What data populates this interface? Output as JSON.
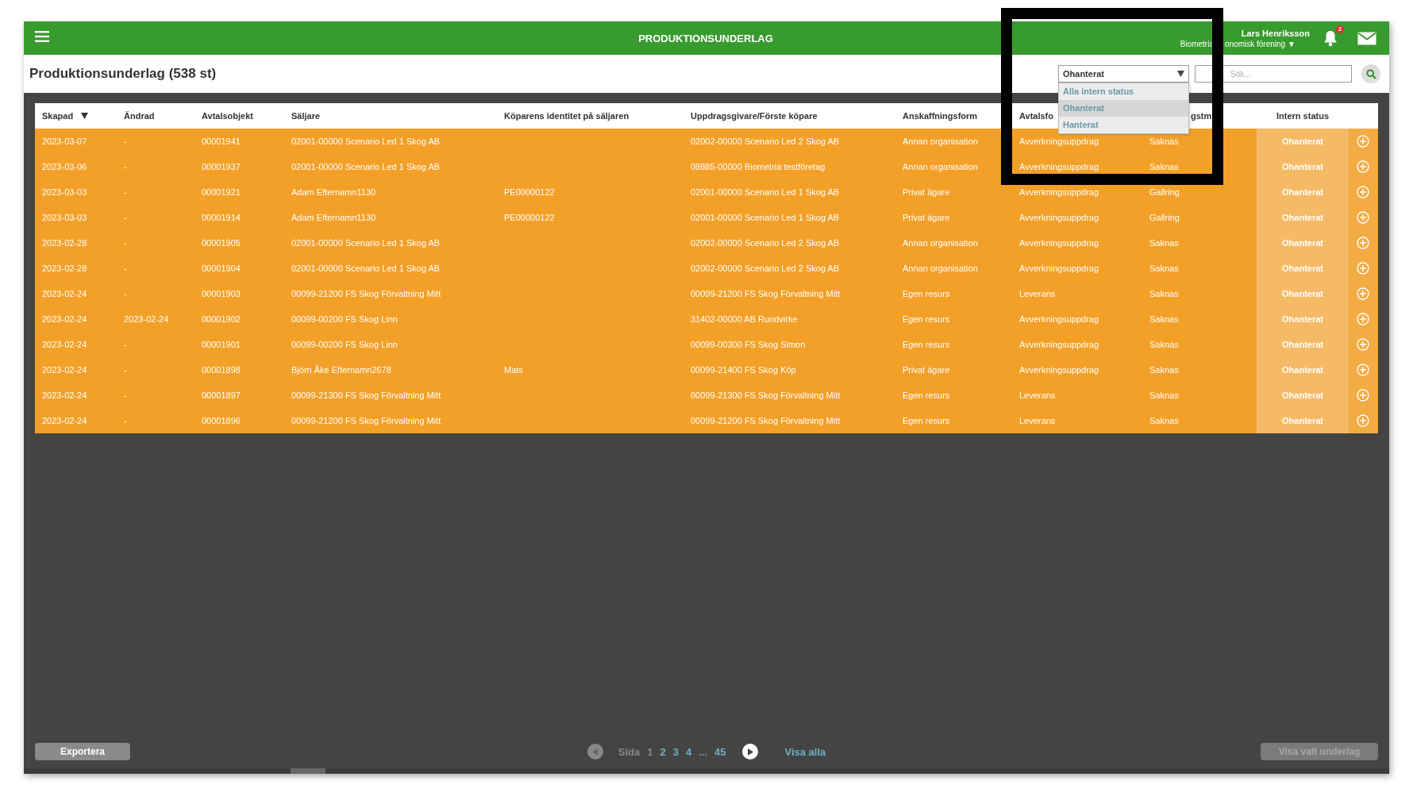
{
  "header": {
    "title": "PRODUKTIONSUNDERLAG",
    "user_name": "Lars Henriksson",
    "organization_visible_parts": [
      "Biometria",
      "onomisk förening ▼"
    ],
    "notification_count": "2"
  },
  "page_title": "Produktionsunderlag (538 st)",
  "status_filter": {
    "value": "Ohanterat",
    "expanded": true,
    "options": [
      {
        "label": "Alla intern status",
        "selected": false
      },
      {
        "label": "Ohanterat",
        "selected": true
      },
      {
        "label": "Hanterat",
        "selected": false
      }
    ]
  },
  "search": {
    "placeholder": "Sök..."
  },
  "table": {
    "columns": [
      {
        "label": "Skapad",
        "sorted": true
      },
      {
        "label": "Ändrad",
        "sorted": false
      },
      {
        "label": "Avtalsobjekt",
        "sorted": false
      },
      {
        "label": "Säljare",
        "sorted": false
      },
      {
        "label": "Köparens identitet på säljaren",
        "sorted": false
      },
      {
        "label": "Uppdragsgivare/Förste köpare",
        "sorted": false
      },
      {
        "label": "Anskaffningsform",
        "sorted": false
      },
      {
        "label": "Avtalsfo"
      },
      {
        "label": "gstm"
      },
      {
        "label": "Intern status",
        "sorted": false
      }
    ],
    "rows": [
      {
        "cells": [
          "2023-03-07",
          "-",
          "00001941",
          "02001-00000 Scenario Led 1 Skog AB",
          null,
          "02002-00000 Scenario Led 2 Skog AB",
          "Annan organisation",
          "Avverkningsuppdrag",
          "Saknas"
        ],
        "intern_status": "Ohanterat"
      },
      {
        "cells": [
          "2023-03-06",
          "-",
          "00001937",
          "02001-00000 Scenario Led 1 Skog AB",
          null,
          "08885-00000 Biometria testföretag",
          "Annan organisation",
          "Avverkningsuppdrag",
          "Saknas"
        ],
        "intern_status": "Ohanterat"
      },
      {
        "cells": [
          "2023-03-03",
          "-",
          "00001921",
          "Adam Efternamn1130",
          "PE00000122",
          "02001-00000 Scenario Led 1 Skog AB",
          "Privat ägare",
          "Avverkningsuppdrag",
          "Gallring"
        ],
        "intern_status": "Ohanterat"
      },
      {
        "cells": [
          "2023-03-03",
          "-",
          "00001914",
          "Adam Efternamn1130",
          "PE00000122",
          "02001-00000 Scenario Led 1 Skog AB",
          "Privat ägare",
          "Avverkningsuppdrag",
          "Gallring"
        ],
        "intern_status": "Ohanterat"
      },
      {
        "cells": [
          "2023-02-28",
          "-",
          "00001905",
          "02001-00000 Scenario Led 1 Skog AB",
          null,
          "02002-00000 Scenario Led 2 Skog AB",
          "Annan organisation",
          "Avverkningsuppdrag",
          "Saknas"
        ],
        "intern_status": "Ohanterat"
      },
      {
        "cells": [
          "2023-02-28",
          "-",
          "00001904",
          "02001-00000 Scenario Led 1 Skog AB",
          null,
          "02002-00000 Scenario Led 2 Skog AB",
          "Annan organisation",
          "Avverkningsuppdrag",
          "Saknas"
        ],
        "intern_status": "Ohanterat"
      },
      {
        "cells": [
          "2023-02-24",
          "-",
          "00001903",
          "00099-21200 FS Skog Förvaltning Mitt",
          null,
          "00099-21200 FS Skog Förvaltning Mitt",
          "Egen resurs",
          "Leverans",
          "Saknas"
        ],
        "intern_status": "Ohanterat"
      },
      {
        "cells": [
          "2023-02-24",
          "2023-02-24",
          "00001902",
          "00099-00200 FS Skog Linn",
          null,
          "31402-00000 AB Rundvirke",
          "Egen resurs",
          "Avverkningsuppdrag",
          "Saknas"
        ],
        "intern_status": "Ohanterat"
      },
      {
        "cells": [
          "2023-02-24",
          "-",
          "00001901",
          "00099-00200 FS Skog Linn",
          null,
          "00099-00300 FS Skog Simon",
          "Egen resurs",
          "Avverkningsuppdrag",
          "Saknas"
        ],
        "intern_status": "Ohanterat"
      },
      {
        "cells": [
          "2023-02-24",
          "-",
          "00001898",
          "Björn Åke Efternamn2678",
          "Mats",
          "00099-21400 FS Skog Köp",
          "Privat ägare",
          "Avverkningsuppdrag",
          "Saknas"
        ],
        "intern_status": "Ohanterat"
      },
      {
        "cells": [
          "2023-02-24",
          "-",
          "00001897",
          "00099-21300 FS Skog Förvaltning Mitt",
          null,
          "00099-21300 FS Skog Förvaltning Mitt",
          "Egen resurs",
          "Leverans",
          "Saknas"
        ],
        "intern_status": "Ohanterat"
      },
      {
        "cells": [
          "2023-02-24",
          "-",
          "00001896",
          "00099-21200 FS Skog Förvaltning Mitt",
          null,
          "00099-21200 FS Skog Förvaltning Mitt",
          "Egen resurs",
          "Leverans",
          "Saknas"
        ],
        "intern_status": "Ohanterat"
      }
    ]
  },
  "export_button": {
    "label": "Exportera"
  },
  "pagination": {
    "label": "Sida",
    "items": [
      {
        "kind": "page",
        "label": "1",
        "selected": true
      },
      {
        "kind": "page",
        "label": "2",
        "selected": false
      },
      {
        "kind": "page",
        "label": "3",
        "selected": false
      },
      {
        "kind": "page",
        "label": "4",
        "selected": false
      },
      {
        "kind": "ellipsis",
        "label": "..."
      },
      {
        "kind": "page",
        "label": "45",
        "selected": false
      }
    ],
    "previous_disabled": true,
    "show_all": "Visa alla"
  },
  "show_selected_button": {
    "label": "Visa valt underlag",
    "disabled": true
  }
}
